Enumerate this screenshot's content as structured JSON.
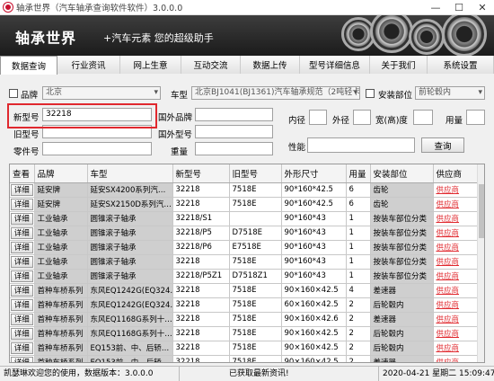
{
  "window": {
    "title": "轴承世界（汽车轴承查询软件软件）3.0.0.0",
    "minimize": "—",
    "maximize": "☐",
    "close": "✕"
  },
  "banner": {
    "brand": "轴承世界",
    "slogan": "+汽车元素  您的超级助手"
  },
  "tabs": [
    "数据查询",
    "行业资讯",
    "网上生意",
    "互动交流",
    "数据上传",
    "型号详细信息",
    "关于我们",
    "系统设置"
  ],
  "filters": {
    "brand_label": "品牌",
    "brand_value": "北京",
    "model_label": "车型",
    "model_value": "北京BJ1041(BJ1361)汽车轴承规范（2吨轻卡）",
    "position_label": "安装部位",
    "position_value": "前轮毂内",
    "new_model_label": "新型号",
    "new_model_value": "32218",
    "foreign_brand_label": "国外品牌",
    "foreign_brand_value": "",
    "inner_label": "内径",
    "outer_label": "外径",
    "width_label": "宽(高)度",
    "qty_label": "用量",
    "old_model_label": "旧型号",
    "old_model_value": "",
    "foreign_model_label": "国外型号",
    "foreign_model_value": "",
    "part_no_label": "零件号",
    "part_no_value": "",
    "weight_label": "重量",
    "weight_value": "",
    "performance_label": "性能",
    "performance_value": "",
    "query_button": "查询"
  },
  "table": {
    "headers": [
      "查看",
      "品牌",
      "车型",
      "新型号",
      "旧型号",
      "外形尺寸",
      "用量",
      "安装部位",
      "供应商"
    ],
    "rows": [
      [
        "详细",
        "延安牌",
        "延安SX4200系列汽…",
        "32218",
        "7518E",
        "90*160*42.5",
        "6",
        "齿轮",
        "供应商"
      ],
      [
        "详细",
        "延安牌",
        "延安SX2150D系列汽…",
        "32218",
        "7518E",
        "90*160*42.5",
        "6",
        "齿轮",
        "供应商"
      ],
      [
        "详细",
        "工业轴承",
        "圆锥滚子轴承",
        "32218/S1",
        "",
        "90*160*43",
        "1",
        "按装车部位分类",
        "供应商"
      ],
      [
        "详细",
        "工业轴承",
        "圆锥滚子轴承",
        "32218/P5",
        "D7518E",
        "90*160*43",
        "1",
        "按装车部位分类",
        "供应商"
      ],
      [
        "详细",
        "工业轴承",
        "圆锥滚子轴承",
        "32218/P6",
        "E7518E",
        "90*160*43",
        "1",
        "按装车部位分类",
        "供应商"
      ],
      [
        "详细",
        "工业轴承",
        "圆锥滚子轴承",
        "32218",
        "7518E",
        "90*160*43",
        "1",
        "按装车部位分类",
        "供应商"
      ],
      [
        "详细",
        "工业轴承",
        "圆锥滚子轴承",
        "32218/P5Z1",
        "D7518Z1",
        "90*160*43",
        "1",
        "按装车部位分类",
        "供应商"
      ],
      [
        "详细",
        "首种车桥系列",
        "东风EQ1242G(EQ324…",
        "32218",
        "7518E",
        "90×160×42.5",
        "4",
        "差速器",
        "供应商"
      ],
      [
        "详细",
        "首种车桥系列",
        "东风EQ1242G(EQ324…",
        "32218",
        "7518E",
        "60×160×42.5",
        "2",
        "后轮毂内",
        "供应商"
      ],
      [
        "详细",
        "首种车桥系列",
        "东风EQ1168G系列十…",
        "32218",
        "7518E",
        "90×160×42.6",
        "2",
        "差速器",
        "供应商"
      ],
      [
        "详细",
        "首种车桥系列",
        "东风EQ1168G系列十…",
        "32218",
        "7518E",
        "90×160×42.5",
        "2",
        "后轮毂内",
        "供应商"
      ],
      [
        "详细",
        "首种车桥系列",
        "EQ153前、中、后轿…",
        "32218",
        "7518E",
        "90×160×42.5",
        "2",
        "后轮毂内",
        "供应商"
      ],
      [
        "详细",
        "首种车桥系列",
        "EQ153前、中、后轿…",
        "32218",
        "7518E",
        "90×160×42.5",
        "2",
        "差速器",
        "供应商"
      ]
    ]
  },
  "status": {
    "welcome": "凯瑟琳欢迎您的使用，数据版本：3.0.0.0",
    "message": "已获取最新资讯!",
    "datetime": "2020-04-21 星期二 15:09:47"
  }
}
